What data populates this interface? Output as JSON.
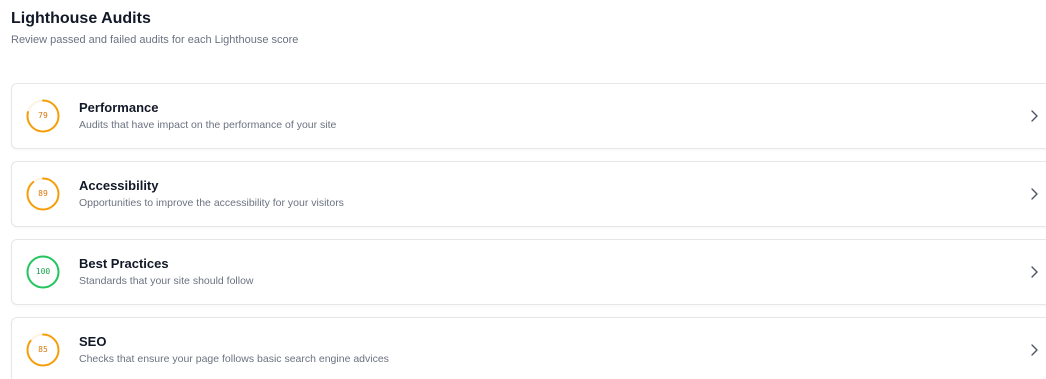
{
  "header": {
    "title": "Lighthouse Audits",
    "subtitle": "Review passed and failed audits for each Lighthouse score"
  },
  "audits": [
    {
      "score": 79,
      "score_text": "79",
      "title": "Performance",
      "description": "Audits that have impact on the performance of your site",
      "color": "#f59e0b",
      "text_color": "#d97706",
      "track_color": "#fef3e2"
    },
    {
      "score": 89,
      "score_text": "89",
      "title": "Accessibility",
      "description": "Opportunities to improve the accessibility for your visitors",
      "color": "#f59e0b",
      "text_color": "#d97706",
      "track_color": "#fef3e2"
    },
    {
      "score": 100,
      "score_text": "100",
      "title": "Best Practices",
      "description": "Standards that your site should follow",
      "color": "#22c55e",
      "text_color": "#16a34a",
      "track_color": "#dcfce7"
    },
    {
      "score": 85,
      "score_text": "85",
      "title": "SEO",
      "description": "Checks that ensure your page follows basic search engine advices",
      "color": "#f59e0b",
      "text_color": "#d97706",
      "track_color": "#fef3e2"
    }
  ],
  "icons": {
    "chevron": "chevron-right-icon"
  }
}
